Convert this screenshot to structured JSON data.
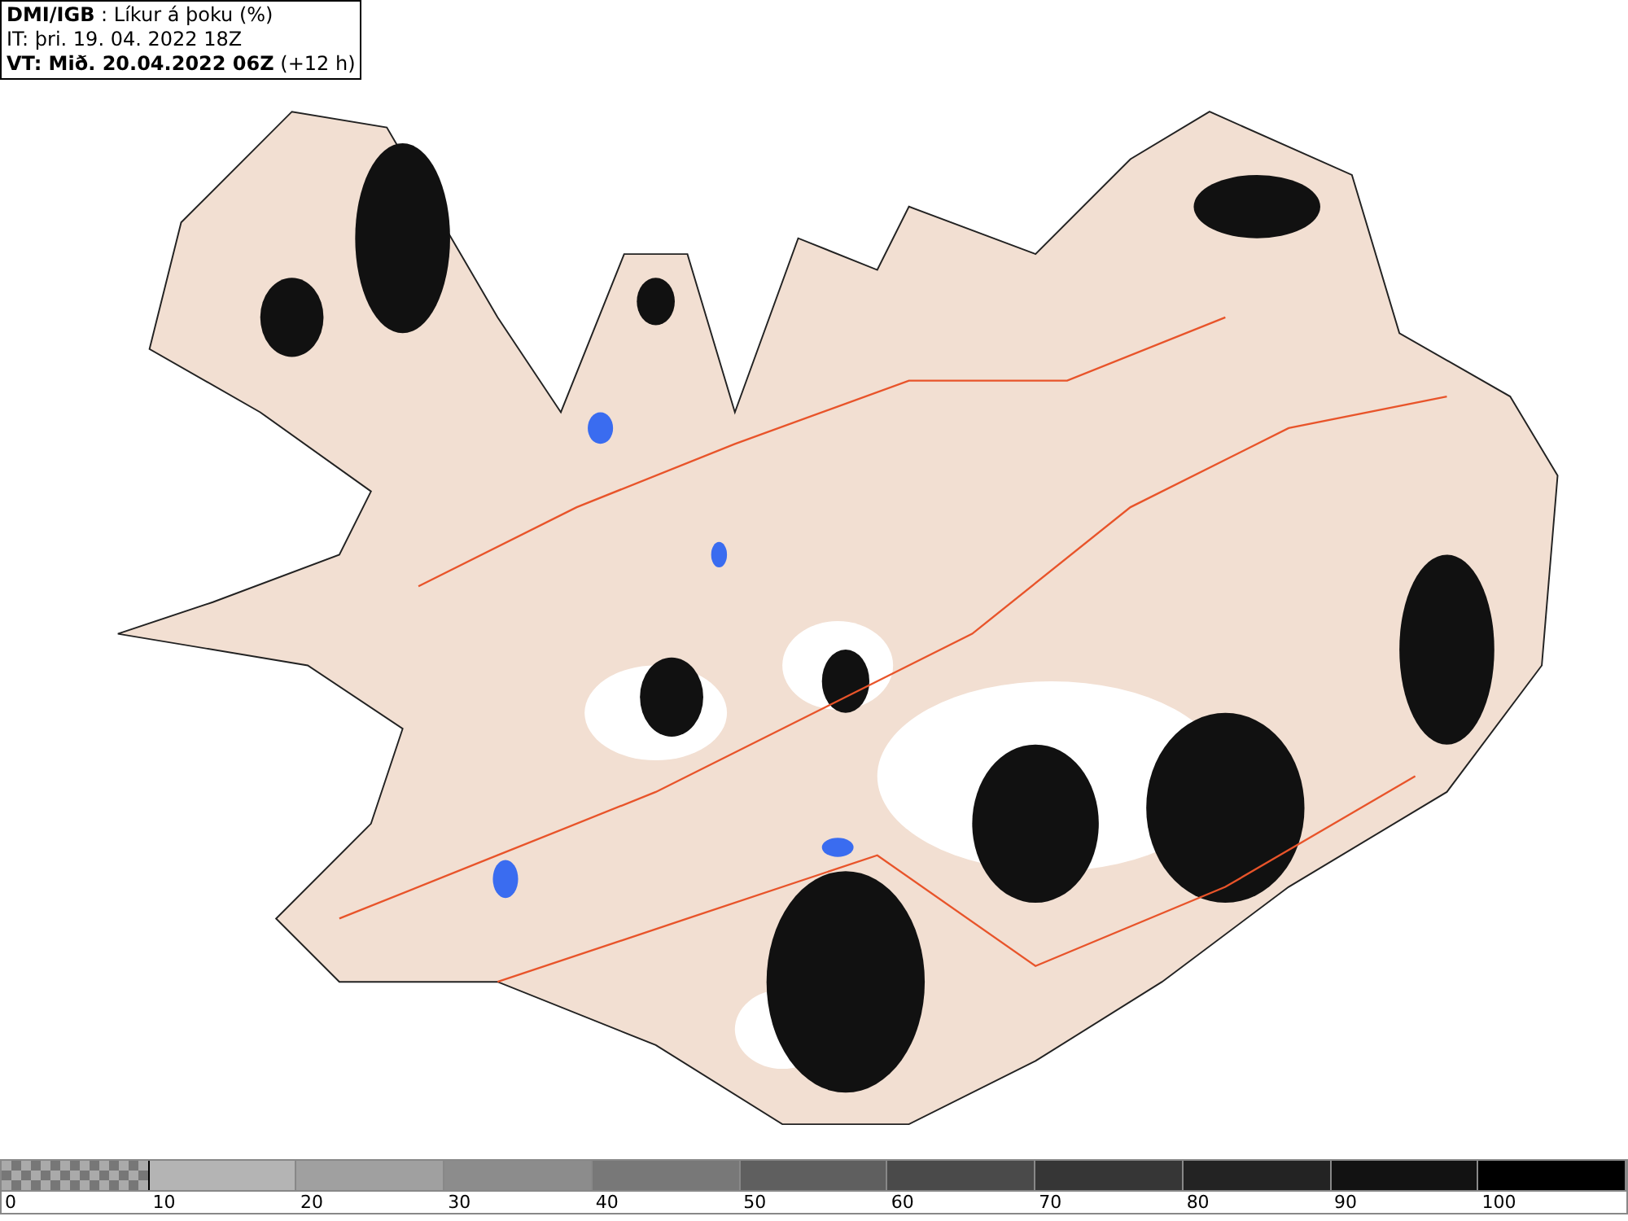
{
  "header": {
    "lines": [
      "**DMI/IGB** : Líkur á þoku (%)",
      "IT: þri. 19. 04. 2022 18Z",
      "**VT: Mið. 20.04.2022 06Z** (+12 h)"
    ]
  },
  "legend": [
    {
      "kind": "checkered",
      "label": "0"
    },
    {
      "kind": "solid",
      "color": "#b4b4b4",
      "label": "10"
    },
    {
      "kind": "solid",
      "color": "#a0a0a0",
      "label": "20"
    },
    {
      "kind": "solid",
      "color": "#8c8c8c",
      "label": "30"
    },
    {
      "kind": "solid",
      "color": "#787878",
      "label": "40"
    },
    {
      "kind": "solid",
      "color": "#5f5f5f",
      "label": "50"
    },
    {
      "kind": "solid",
      "color": "#4a4a4a",
      "label": "60"
    },
    {
      "kind": "solid",
      "color": "#363636",
      "label": "70"
    },
    {
      "kind": "solid",
      "color": "#232323",
      "label": "80"
    },
    {
      "kind": "solid",
      "color": "#121212",
      "label": "90"
    },
    {
      "kind": "solid",
      "color": "#000000",
      "label": "100"
    }
  ]
}
